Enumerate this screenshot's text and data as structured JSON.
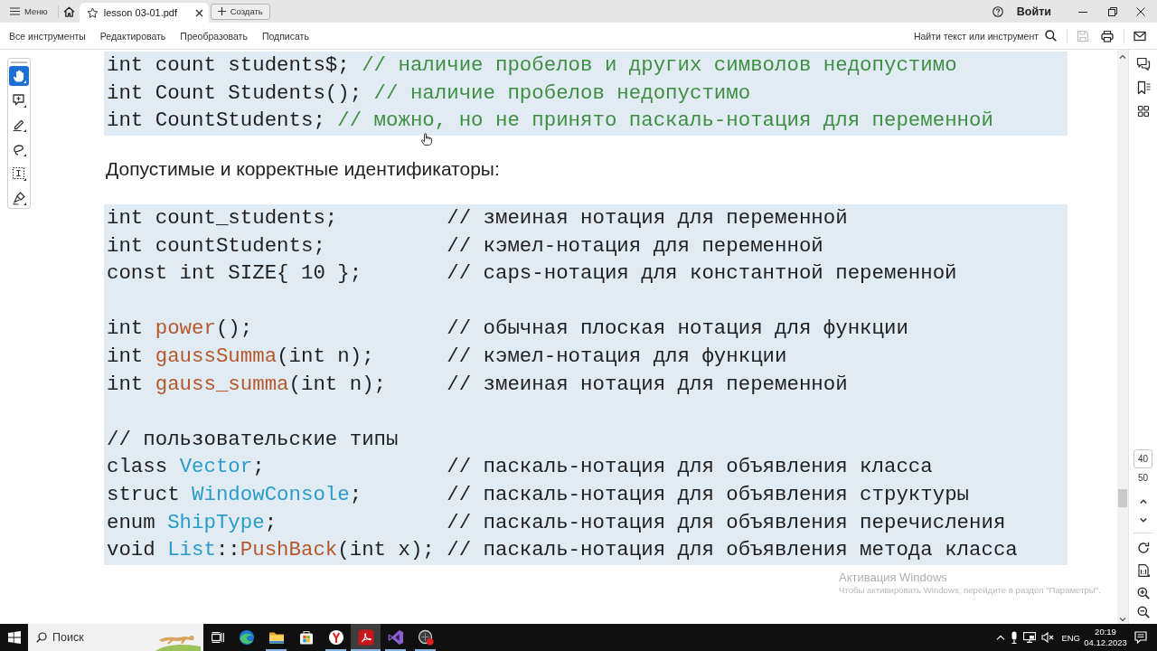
{
  "title_bar": {
    "menu": {
      "label": "Меню"
    },
    "tabs": [
      {
        "label": "lesson 03-01.pdf",
        "selected": true
      }
    ],
    "create_button": {
      "label": "Создать"
    },
    "sign_in": {
      "label": "Войти"
    }
  },
  "toolbar": {
    "menu_items": [
      {
        "label": "Все инструменты"
      },
      {
        "label": "Редактировать"
      },
      {
        "label": "Преобразовать"
      },
      {
        "label": "Подписать"
      }
    ],
    "find": {
      "label": "Найти текст или инструмент"
    },
    "actions": [
      {
        "kind": "save",
        "disabled": true
      },
      {
        "kind": "print",
        "disabled": false
      },
      {
        "kind": "mail",
        "disabled": false
      }
    ]
  },
  "tools": [
    {
      "kind": "hand",
      "selected": true
    },
    {
      "kind": "comment",
      "selected": false
    },
    {
      "kind": "pencil",
      "selected": false
    },
    {
      "kind": "lasso",
      "selected": false
    },
    {
      "kind": "textbox",
      "selected": false
    },
    {
      "kind": "signature",
      "selected": false
    }
  ],
  "document": {
    "blocks": [
      {
        "kind": "code",
        "groups": [
          [
            {
              "segments": [
                {
                  "kind": "text",
                  "text": "int count students$; "
                },
                {
                  "kind": "comment",
                  "text": "// наличие пробелов и других символов недопустимо"
                }
              ]
            },
            {
              "segments": [
                {
                  "kind": "text",
                  "text": "int Count Students(); "
                },
                {
                  "kind": "comment",
                  "text": "// наличие пробелов недопустимо"
                }
              ]
            },
            {
              "segments": [
                {
                  "kind": "text",
                  "text": "int CountStudents; "
                },
                {
                  "kind": "comment",
                  "text": "// можно, но не принято паскаль-нотация для переменной"
                }
              ]
            }
          ]
        ]
      },
      {
        "kind": "paragraph",
        "text": "Допустимые и корректные идентификаторы:"
      },
      {
        "kind": "code",
        "groups": [
          [
            {
              "segments": [
                {
                  "kind": "text",
                  "text": "int count_students;         // змеиная нотация для переменной"
                }
              ]
            },
            {
              "segments": [
                {
                  "kind": "text",
                  "text": "int countStudents;          // кэмел-нотация для переменной"
                }
              ]
            },
            {
              "segments": [
                {
                  "kind": "text",
                  "text": "const int SIZE{ 10 };       // caps-нотация для константной переменной"
                }
              ]
            }
          ],
          [
            {
              "segments": [
                {
                  "kind": "text",
                  "text": "int "
                },
                {
                  "kind": "function",
                  "text": "power"
                },
                {
                  "kind": "text",
                  "text": "();                // обычная плоская нотация для функции"
                }
              ]
            },
            {
              "segments": [
                {
                  "kind": "text",
                  "text": "int "
                },
                {
                  "kind": "function",
                  "text": "gaussSumma"
                },
                {
                  "kind": "text",
                  "text": "(int n);      // кэмел-нотация для функции"
                }
              ]
            },
            {
              "segments": [
                {
                  "kind": "text",
                  "text": "int "
                },
                {
                  "kind": "function",
                  "text": "gauss_summa"
                },
                {
                  "kind": "text",
                  "text": "(int n);     // змеиная нотация для переменной"
                }
              ]
            }
          ],
          [
            {
              "segments": [
                {
                  "kind": "text",
                  "text": "// пользовательские типы"
                }
              ]
            },
            {
              "segments": [
                {
                  "kind": "text",
                  "text": "class "
                },
                {
                  "kind": "type",
                  "text": "Vector"
                },
                {
                  "kind": "text",
                  "text": ";               // паскаль-нотация для объявления класса"
                }
              ]
            },
            {
              "segments": [
                {
                  "kind": "text",
                  "text": "struct "
                },
                {
                  "kind": "type",
                  "text": "WindowConsole"
                },
                {
                  "kind": "text",
                  "text": ";       // паскаль-нотация для объявления структуры"
                }
              ]
            },
            {
              "segments": [
                {
                  "kind": "text",
                  "text": "enum "
                },
                {
                  "kind": "type",
                  "text": "ShipType"
                },
                {
                  "kind": "text",
                  "text": ";              // паскаль-нотация для объявления перечисления"
                }
              ]
            },
            {
              "segments": [
                {
                  "kind": "text",
                  "text": "void "
                },
                {
                  "kind": "type",
                  "text": "List"
                },
                {
                  "kind": "text",
                  "text": "::"
                },
                {
                  "kind": "function",
                  "text": "PushBack"
                },
                {
                  "kind": "text",
                  "text": "(int x); // паскаль-нотация для объявления метода класса"
                }
              ]
            }
          ]
        ]
      }
    ]
  },
  "page_nav": {
    "page_field": {
      "value": "40"
    },
    "page_count": "50"
  },
  "activation_notice": {
    "title": "Активация Windows",
    "text": "Чтобы активировать Windows, перейдите в раздел \"Параметры\"."
  },
  "taskbar": {
    "search": {
      "placeholder": "Поиск"
    },
    "apps": [
      {
        "kind": "wave",
        "running": false,
        "active": false
      },
      {
        "kind": "folder",
        "running": true,
        "active": false
      },
      {
        "kind": "bag",
        "running": false,
        "active": false
      },
      {
        "kind": "fork",
        "running": true,
        "active": false
      },
      {
        "kind": "pdf",
        "running": true,
        "active": true
      },
      {
        "kind": "ribbon",
        "running": true,
        "active": false
      },
      {
        "kind": "disc",
        "running": true,
        "active": false
      }
    ],
    "tray": {
      "language": "ENG",
      "time": "20:19",
      "date": "04.12.2023"
    }
  }
}
